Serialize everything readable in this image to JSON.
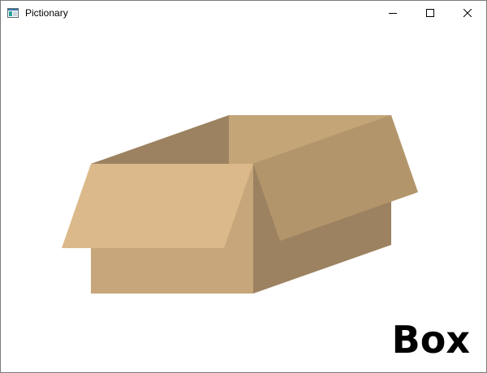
{
  "window": {
    "title": "Pictionary",
    "icon": "app-window-icon",
    "controls": {
      "minimize_icon": "minimize-icon",
      "maximize_icon": "maximize-icon",
      "close_icon": "close-icon"
    }
  },
  "drawing": {
    "subject_icon": "open-cardboard-box-icon",
    "colors": {
      "interior_back": "#9c8260",
      "interior_right": "#c4a578",
      "front_face": "#c6a67a",
      "side_face": "#9c8260",
      "left_flap": "#dcb98a",
      "right_flap": "#b3956c"
    },
    "caption": "Box"
  }
}
